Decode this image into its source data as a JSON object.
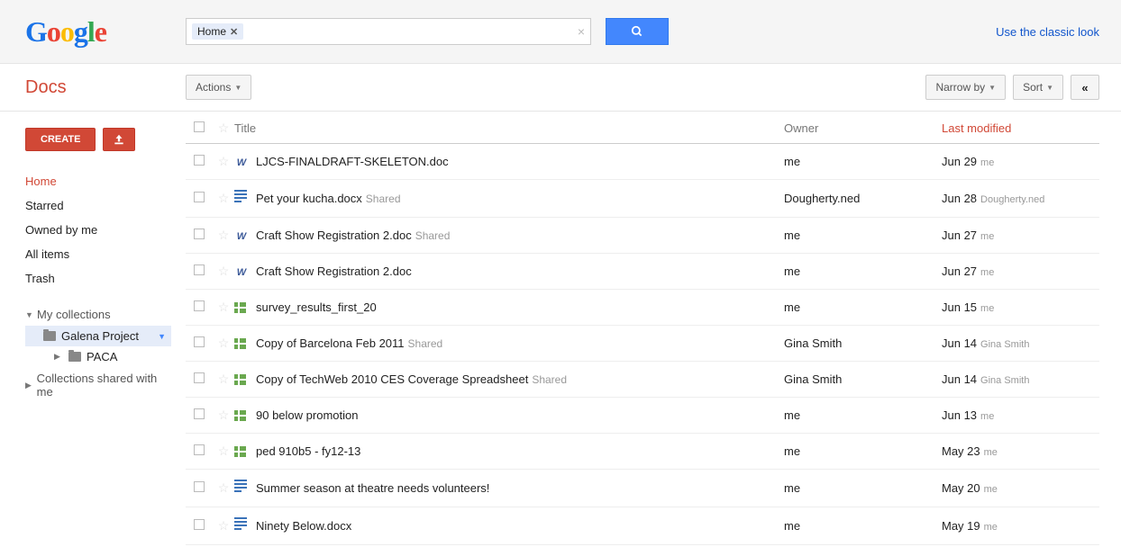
{
  "header": {
    "logo_alt": "Google",
    "search_chip": "Home",
    "classic_link": "Use the classic look"
  },
  "docs_title": "Docs",
  "toolbar": {
    "actions_label": "Actions",
    "narrow_label": "Narrow by",
    "sort_label": "Sort"
  },
  "sidebar": {
    "create_label": "CREATE",
    "nav": [
      {
        "label": "Home",
        "active": true
      },
      {
        "label": "Starred",
        "active": false
      },
      {
        "label": "Owned by me",
        "active": false
      },
      {
        "label": "All items",
        "active": false
      },
      {
        "label": "Trash",
        "active": false
      }
    ],
    "my_collections_label": "My collections",
    "collections": [
      {
        "label": "Galena Project",
        "selected": true
      },
      {
        "label": "PACA",
        "selected": false
      }
    ],
    "shared_label": "Collections shared with me"
  },
  "columns": {
    "title": "Title",
    "owner": "Owner",
    "modified": "Last modified"
  },
  "rows": [
    {
      "icon": "word",
      "title": "LJCS-FINALDRAFT-SKELETON.doc",
      "shared": false,
      "owner": "me",
      "date": "Jun 29",
      "by": "me"
    },
    {
      "icon": "gdoc",
      "title": "Pet your kucha.docx",
      "shared": true,
      "owner": "Dougherty.ned",
      "date": "Jun 28",
      "by": "Dougherty.ned"
    },
    {
      "icon": "word",
      "title": "Craft Show Registration 2.doc",
      "shared": true,
      "owner": "me",
      "date": "Jun 27",
      "by": "me"
    },
    {
      "icon": "word",
      "title": "Craft Show Registration 2.doc",
      "shared": false,
      "owner": "me",
      "date": "Jun 27",
      "by": "me"
    },
    {
      "icon": "sheet",
      "title": "survey_results_first_20",
      "shared": false,
      "owner": "me",
      "date": "Jun 15",
      "by": "me"
    },
    {
      "icon": "sheet",
      "title": "Copy of Barcelona Feb 2011",
      "shared": true,
      "owner": "Gina Smith",
      "date": "Jun 14",
      "by": "Gina Smith"
    },
    {
      "icon": "sheet",
      "title": "Copy of TechWeb 2010 CES Coverage Spreadsheet",
      "shared": true,
      "owner": "Gina Smith",
      "date": "Jun 14",
      "by": "Gina Smith"
    },
    {
      "icon": "sheet",
      "title": "90 below promotion",
      "shared": false,
      "owner": "me",
      "date": "Jun 13",
      "by": "me"
    },
    {
      "icon": "sheet",
      "title": "ped 910b5 - fy12-13",
      "shared": false,
      "owner": "me",
      "date": "May 23",
      "by": "me"
    },
    {
      "icon": "gdoc",
      "title": "Summer season at theatre needs volunteers!",
      "shared": false,
      "owner": "me",
      "date": "May 20",
      "by": "me"
    },
    {
      "icon": "gdoc",
      "title": "Ninety Below.docx",
      "shared": false,
      "owner": "me",
      "date": "May 19",
      "by": "me"
    }
  ],
  "shared_text": "Shared"
}
